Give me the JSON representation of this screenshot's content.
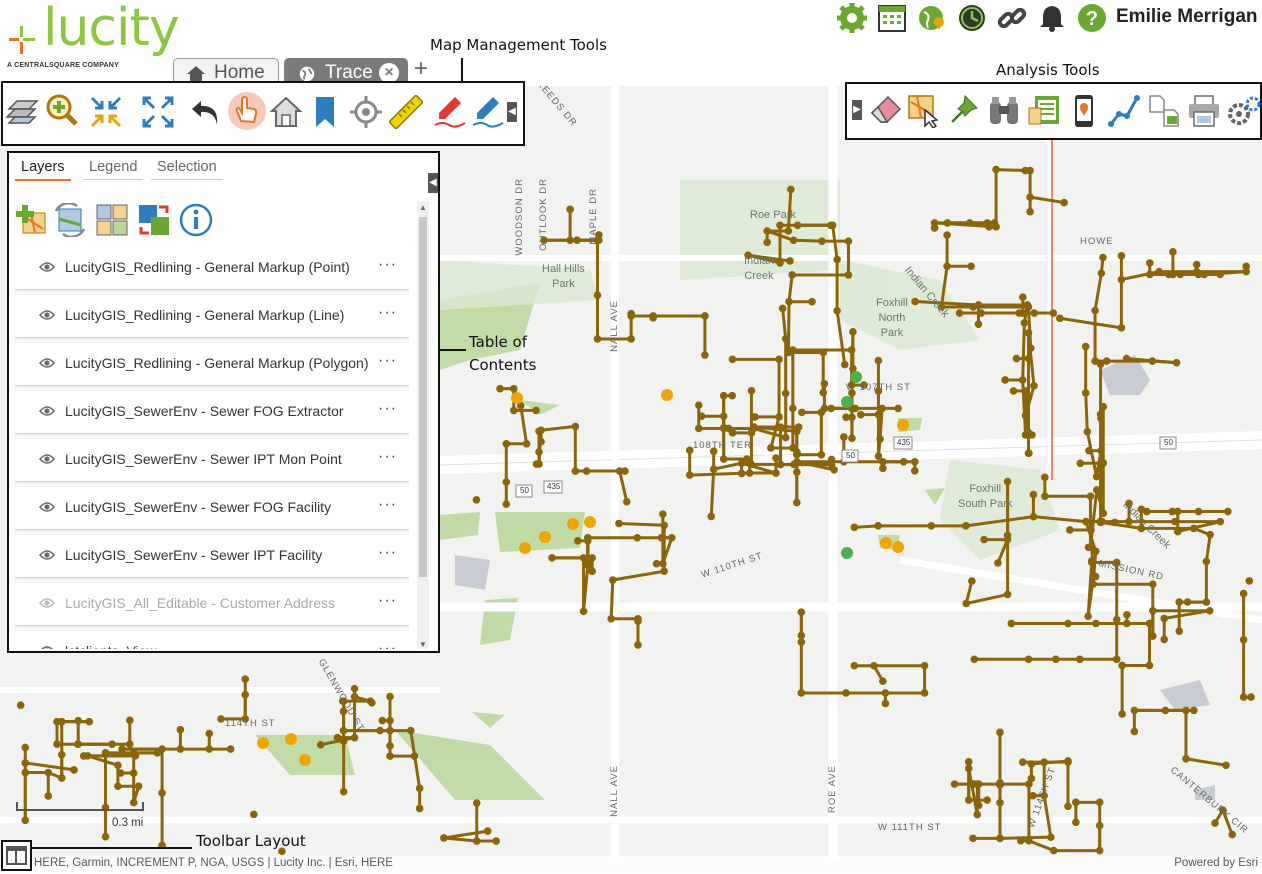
{
  "app": {
    "logo_text": "lucity",
    "logo_subtitle": "A CENTRALSQUARE COMPANY",
    "user_name": "Emilie Merrigan",
    "accent_color": "#8dc63f",
    "pipe_color": "#8b6508"
  },
  "tabs": [
    {
      "label": "Home",
      "icon": "home-icon",
      "active": false
    },
    {
      "label": "Trace",
      "icon": "globe-icon",
      "active": true
    }
  ],
  "tab_add": "+",
  "tab_close": "×",
  "header_icons": [
    "gear-icon",
    "calendar-icon",
    "globe-pin-icon",
    "clock-icon",
    "link-icon",
    "bell-icon",
    "help-icon"
  ],
  "annotations": {
    "map_management": "Map Management Tools",
    "analysis": "Analysis Tools",
    "toc_line1": "Table of",
    "toc_line2": "Contents",
    "toolbar_layout": "Toolbar Layout"
  },
  "map_tools": [
    "basemap-icon",
    "zoom-in-icon",
    "zoom-out-icon",
    "full-extent-icon",
    "back-icon",
    "pan-icon",
    "home-extent-icon",
    "bookmark-icon",
    "locate-icon",
    "measure-icon",
    "markup-red-icon",
    "markup-blue-icon"
  ],
  "analysis_tools": [
    "eraser-icon",
    "select-icon",
    "pin-icon",
    "binoculars-icon",
    "identify-icon",
    "mobile-icon",
    "trace-icon",
    "documents-icon",
    "print-icon",
    "settings-icon"
  ],
  "toc": {
    "tabs": [
      "Layers",
      "Legend",
      "Selection"
    ],
    "active_tab": "Layers",
    "tools": [
      "add-layer-icon",
      "refresh-layers-icon",
      "layer-grid-icon",
      "swap-layers-icon",
      "info-icon"
    ],
    "layers": [
      {
        "name": "LucityGIS_Redlining - General Markup (Point)",
        "dim": false
      },
      {
        "name": "LucityGIS_Redlining - General Markup (Line)",
        "dim": false
      },
      {
        "name": "LucityGIS_Redlining - General Markup (Polygon)",
        "dim": false
      },
      {
        "name": "LucityGIS_SewerEnv - Sewer FOG Extractor",
        "dim": false
      },
      {
        "name": "LucityGIS_SewerEnv - Sewer IPT Mon Point",
        "dim": false
      },
      {
        "name": "LucityGIS_SewerEnv - Sewer FOG Facility",
        "dim": false
      },
      {
        "name": "LucityGIS_SewerEnv - Sewer IPT Facility",
        "dim": false
      },
      {
        "name": "LucityGIS_All_Editable - Customer Address",
        "dim": true
      },
      {
        "name": "lctclients_View",
        "dim": false
      }
    ],
    "more": "···"
  },
  "map_labels": {
    "roe_park": "Roe Park",
    "indian_creek_1": "Indian",
    "indian_creek_2": "Creek",
    "hall_hills": "Hall Hills",
    "park": "Park",
    "foxhill_north_1": "Foxhill",
    "foxhill_north_2": "North",
    "foxhill_north_3": "Park",
    "foxhill_south_1": "Foxhill",
    "foxhill_south_2": "South Park",
    "indian_creek_diag": "Indian Creek",
    "indian_creek_diag2": "Indian Creek",
    "nall_ave": "NALL AVE",
    "nall_ave2": "NALL AVE",
    "roe_ave": "ROE AVE",
    "w107": "W 107TH ST",
    "w108": "108TH TER",
    "w110": "W 110TH ST",
    "w111": "W 111TH ST",
    "w114": "114TH ST",
    "w114b": "W 114TH ST",
    "mission": "MISSION RD",
    "howe": "HOWE",
    "woodson": "WOODSON DR",
    "outlook": "OUTLOOK DR",
    "maple": "MAPLE DR",
    "glenwood": "GLENWOOD ST",
    "canterbury": "CANTERBURY CIR",
    "reeds": "REEDS DR",
    "hwy50a": "50",
    "hwy435a": "435",
    "hwy50b": "50",
    "hwy435b": "435",
    "hwy50c": "50"
  },
  "scale_label": "0.3 mi",
  "footer": {
    "attribution": "HERE, Garmin, INCREMENT P, NGA, USGS | Lucity Inc. | Esri, HERE",
    "powered": "Powered by Esri"
  }
}
